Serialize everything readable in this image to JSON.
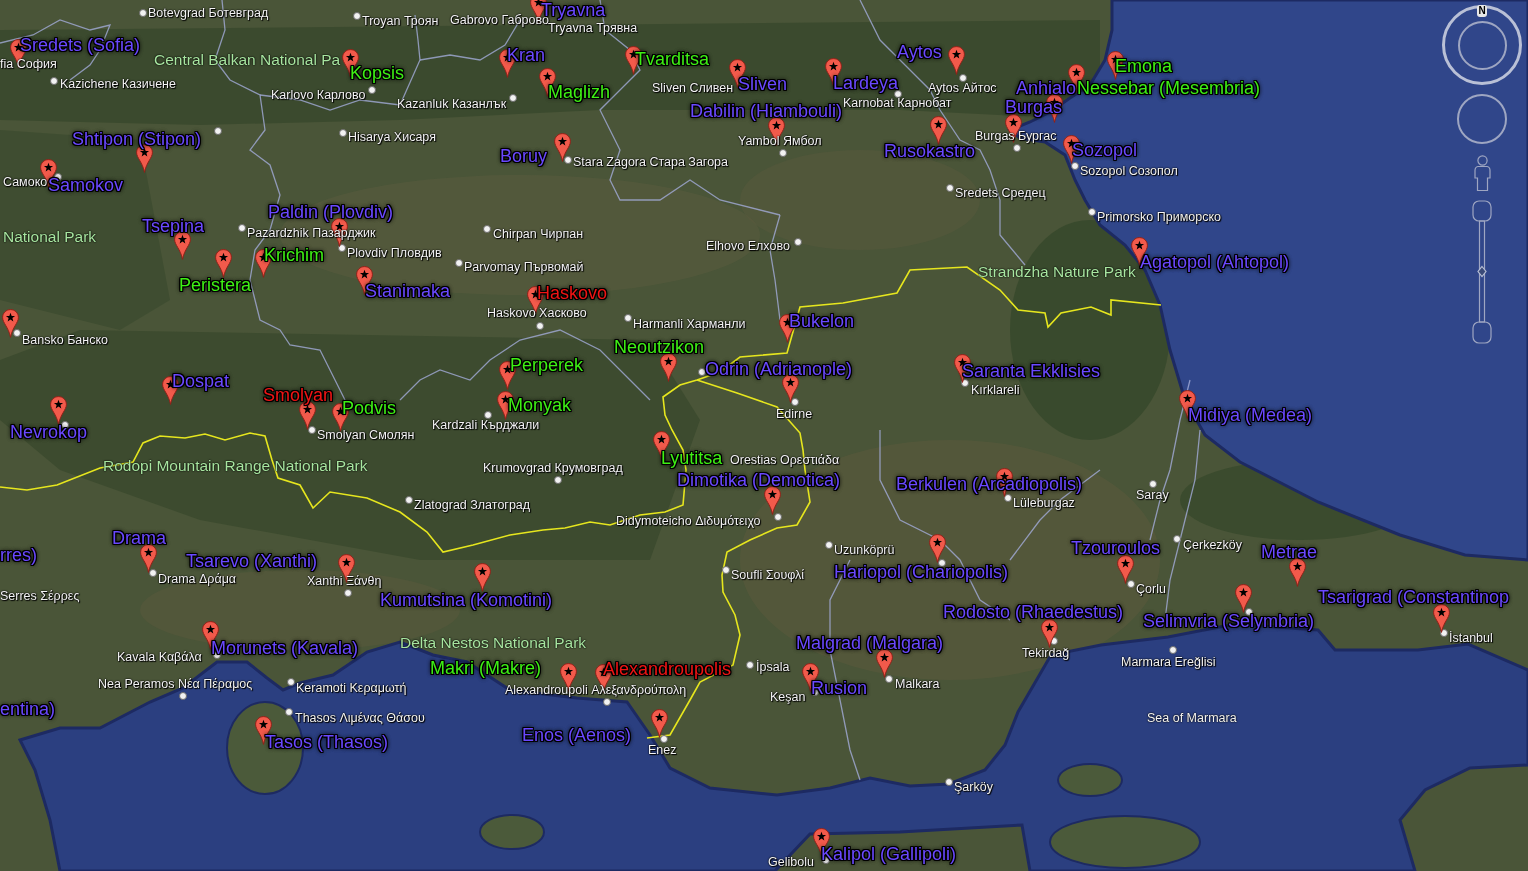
{
  "map": {
    "placemarks": [
      {
        "label": "Tryavna",
        "color": "#6a48ff"
      },
      {
        "label": "Sredets (Sofia)",
        "color": "#6a48ff"
      },
      {
        "label": "Kopsis",
        "color": "#3ef014"
      },
      {
        "label": "Kran",
        "color": "#6a48ff"
      },
      {
        "label": "Tvarditsa",
        "color": "#3ef014"
      },
      {
        "label": "Aytos",
        "color": "#6a48ff"
      },
      {
        "label": "Emona",
        "color": "#3ef014"
      },
      {
        "label": "Maglizh",
        "color": "#3ef014"
      },
      {
        "label": "Sliven",
        "color": "#6a48ff"
      },
      {
        "label": "Lardeya",
        "color": "#6a48ff"
      },
      {
        "label": "Anhialo",
        "color": "#6a48ff"
      },
      {
        "label": "Nessebar (Mesembria)",
        "color": "#3ef014"
      },
      {
        "label": "Dabilin (Hiambouli)",
        "color": "#6a48ff"
      },
      {
        "label": "Burgas",
        "color": "#6a48ff"
      },
      {
        "label": "Shtipon (Stipon)",
        "color": "#6a48ff"
      },
      {
        "label": "Boruy",
        "color": "#6a48ff"
      },
      {
        "label": "Rusokastro",
        "color": "#6a48ff"
      },
      {
        "label": "Sozopol",
        "color": "#6a48ff"
      },
      {
        "label": "Samokov",
        "color": "#6a48ff"
      },
      {
        "label": "Tsepina",
        "color": "#6a48ff"
      },
      {
        "label": "Paldin (Plovdiv)",
        "color": "#6a48ff"
      },
      {
        "label": "Krichim",
        "color": "#3ef014"
      },
      {
        "label": "Agatopol (Ahtopol)",
        "color": "#6a48ff"
      },
      {
        "label": "Peristera",
        "color": "#3ef014"
      },
      {
        "label": "Stanimaka",
        "color": "#6a48ff"
      },
      {
        "label": "Haskovo",
        "color": "#f01414"
      },
      {
        "label": "Bukelon",
        "color": "#6a48ff"
      },
      {
        "label": "Dospat",
        "color": "#6a48ff"
      },
      {
        "label": "Perperek",
        "color": "#3ef014"
      },
      {
        "label": "Neoutzikon",
        "color": "#3ef014"
      },
      {
        "label": "Odrin (Adrianople)",
        "color": "#6a48ff"
      },
      {
        "label": "Saranta Ekklisies",
        "color": "#6a48ff"
      },
      {
        "label": "Nevrokop",
        "color": "#6a48ff"
      },
      {
        "label": "Smolyan",
        "color": "#f01414"
      },
      {
        "label": "Podvis",
        "color": "#3ef014"
      },
      {
        "label": "Monyak",
        "color": "#3ef014"
      },
      {
        "label": "Midiya (Medea)",
        "color": "#6a48ff"
      },
      {
        "label": "Lyutitsa",
        "color": "#3ef014"
      },
      {
        "label": "Dimotika (Demotica)",
        "color": "#6a48ff"
      },
      {
        "label": "Berkulen (Arcadiopolis)",
        "color": "#6a48ff"
      },
      {
        "label": "rres)",
        "color": "#6a48ff"
      },
      {
        "label": "Drama",
        "color": "#6a48ff"
      },
      {
        "label": "Tsarevo (Xanthi)",
        "color": "#6a48ff"
      },
      {
        "label": "Hariopol (Chariopolis)",
        "color": "#6a48ff"
      },
      {
        "label": "Tzouroulos",
        "color": "#6a48ff"
      },
      {
        "label": "Metrae",
        "color": "#6a48ff"
      },
      {
        "label": "Kumutsina (Komotini)",
        "color": "#6a48ff"
      },
      {
        "label": "Rodosto (Rhaedestus)",
        "color": "#6a48ff"
      },
      {
        "label": "Selimvria (Selymbria)",
        "color": "#6a48ff"
      },
      {
        "label": "Tsarigrad (Constantinop",
        "color": "#6a48ff"
      },
      {
        "label": "Morunets (Kavala)",
        "color": "#6a48ff"
      },
      {
        "label": "Malgrad (Malgara)",
        "color": "#6a48ff"
      },
      {
        "label": "Makri (Makre)",
        "color": "#3ef014"
      },
      {
        "label": "Alexandroupolis",
        "color": "#f01414"
      },
      {
        "label": "Rusion",
        "color": "#6a48ff"
      },
      {
        "label": "entina)",
        "color": "#6a48ff"
      },
      {
        "label": "Tasos (Thasos)",
        "color": "#6a48ff"
      },
      {
        "label": "Enos (Aenos)",
        "color": "#6a48ff"
      },
      {
        "label": "Kalipol (Gallipoli)",
        "color": "#6a48ff"
      }
    ],
    "places": [
      "Botevgrad Ботевград",
      "Troyan Троян",
      "Gabrovo Габрово",
      "Tryavna Трявна",
      "fia София",
      "Kazichene Казичене",
      "Karlovo Карлово",
      "Kazanluk Казанлък",
      "Sliven Сливен",
      "Karnobat Карнобат",
      "Aytos Айтос",
      "Hisarya Хисаря",
      "Yambol Ямбол",
      "Burgas Бургас",
      "Самоко",
      "Stara Zagora Стара Загора",
      "Sozopol Созопол",
      "Sredets Средец",
      "Primorsko Приморско",
      "Pazardzhik Пазарджик",
      "Plovdiv Пловдив",
      "Chirpan Чирпан",
      "Elhovo Елхово",
      "Parvomay Първомай",
      "Haskovo Хасково",
      "Harmanli Харманли",
      "Bansko Банско",
      "Kırklareli",
      "Smolyan Смолян",
      "Kardzali Кърджали",
      "Edirne",
      "Krumovgrad Крумовград",
      "Orestias Ορεστιάδα",
      "Zlatograd Златоград",
      "Lüleburgaz",
      "Saray",
      "Didymoteicho Διδυμότειχο",
      "Uzunköprü",
      "Çerkezköy",
      "Serres Σέρρες",
      "Drama Δράμα",
      "Xanthi Ξάνθη",
      "Soufli Σουφλί",
      "Çorlu",
      "İstanbul",
      "Kavala Καβάλα",
      "İpsala",
      "Tekirdağ",
      "Marmara Ereğlisi",
      "Nea Peramos Νέα Πέραμος",
      "Keramoti Κεραμωτή",
      "Alexandroupoli Αλεξανδρούπολη",
      "Keşan",
      "Malkara",
      "Thasos Λιμένας Θάσου",
      "Enez",
      "Şarköy",
      "Gelibolu"
    ],
    "parks": [
      "Central Balkan National Pa",
      "National Park",
      "Strandzha Nature Park",
      "Rodopi Mountain Range National Park",
      "Delta Nestos National Park"
    ],
    "water_labels": [
      "Sea of Marmara"
    ]
  },
  "navigation": {
    "compass": {
      "label": "N"
    },
    "zoom_slider": {
      "level": 0.5
    }
  }
}
